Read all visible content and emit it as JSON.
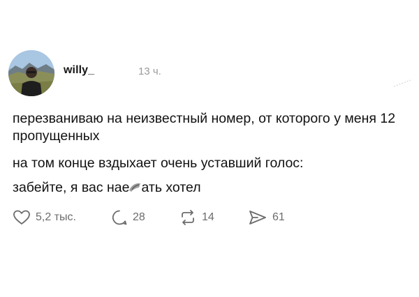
{
  "post": {
    "author": {
      "username": "willy_"
    },
    "time": "13 ч.",
    "body": {
      "line1": "перезваниваю на неизвестный номер, от которого у меня 12 пропущенных",
      "line2": "на том конце вздыхает очень уставший голос:",
      "line3_before": "забейте, я вас нае",
      "line3_after": "ать хотел"
    },
    "actions": {
      "likes": "5,2 тыс.",
      "replies": "28",
      "reposts": "14",
      "shares": "61"
    }
  },
  "colors": {
    "text": "#111111",
    "muted": "#6c6c6c",
    "timestamp": "#9a9a9a"
  },
  "icons": [
    "heart-icon",
    "reply-icon",
    "repost-icon",
    "share-icon"
  ]
}
